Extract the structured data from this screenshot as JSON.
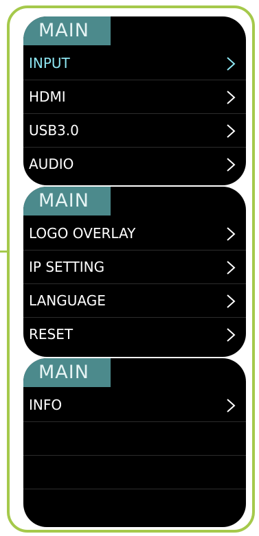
{
  "colors": {
    "frame": "#a5c94b",
    "screen_bg": "#000000",
    "title_bg": "#4c8a8c",
    "active_text": "#8ee6f2",
    "text": "#ffffff"
  },
  "panels": [
    {
      "title": "MAIN",
      "items": [
        {
          "label": "INPUT",
          "icon": "chevron-right-icon",
          "active": true
        },
        {
          "label": "HDMI",
          "icon": "chevron-right-icon"
        },
        {
          "label": "USB3.0",
          "icon": "chevron-right-icon"
        },
        {
          "label": "AUDIO",
          "icon": "chevron-right-icon"
        }
      ]
    },
    {
      "title": "MAIN",
      "items": [
        {
          "label": "LOGO OVERLAY",
          "icon": "chevron-right-icon"
        },
        {
          "label": "IP SETTING",
          "icon": "chevron-right-icon"
        },
        {
          "label": "LANGUAGE",
          "icon": "chevron-right-icon"
        },
        {
          "label": "RESET",
          "icon": "chevron-right-icon"
        }
      ]
    },
    {
      "title": "MAIN",
      "items": [
        {
          "label": "INFO",
          "icon": "chevron-right-icon"
        },
        {
          "label": ""
        },
        {
          "label": ""
        },
        {
          "label": ""
        }
      ]
    }
  ]
}
